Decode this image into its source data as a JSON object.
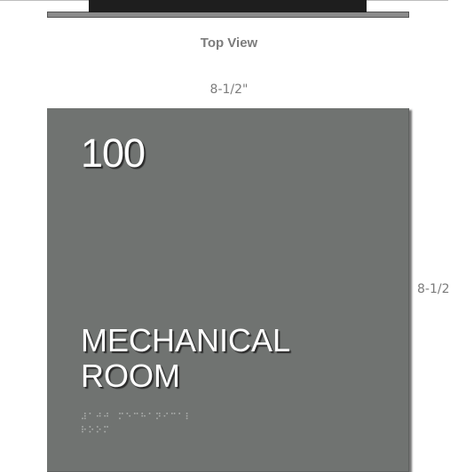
{
  "top_view": {
    "label": "Top View"
  },
  "dimensions": {
    "width": "8-1/2\"",
    "height": "8-1/2"
  },
  "sign": {
    "room_number": "100",
    "room_name_line1": "MECHANICAL",
    "room_name_line2": "ROOM",
    "braille": [
      "⠼⠁⠚⠚ ⠍⠑⠉⠓⠁⠝⠊⠉⠁⠇",
      "⠗⠕⠕⠍"
    ]
  },
  "colors": {
    "sign_face": "#707371",
    "edge_dark": "#1e1e1e",
    "edge_base": "#8a8a8a",
    "caption": "#7c7c7c",
    "text": "#ffffff"
  }
}
